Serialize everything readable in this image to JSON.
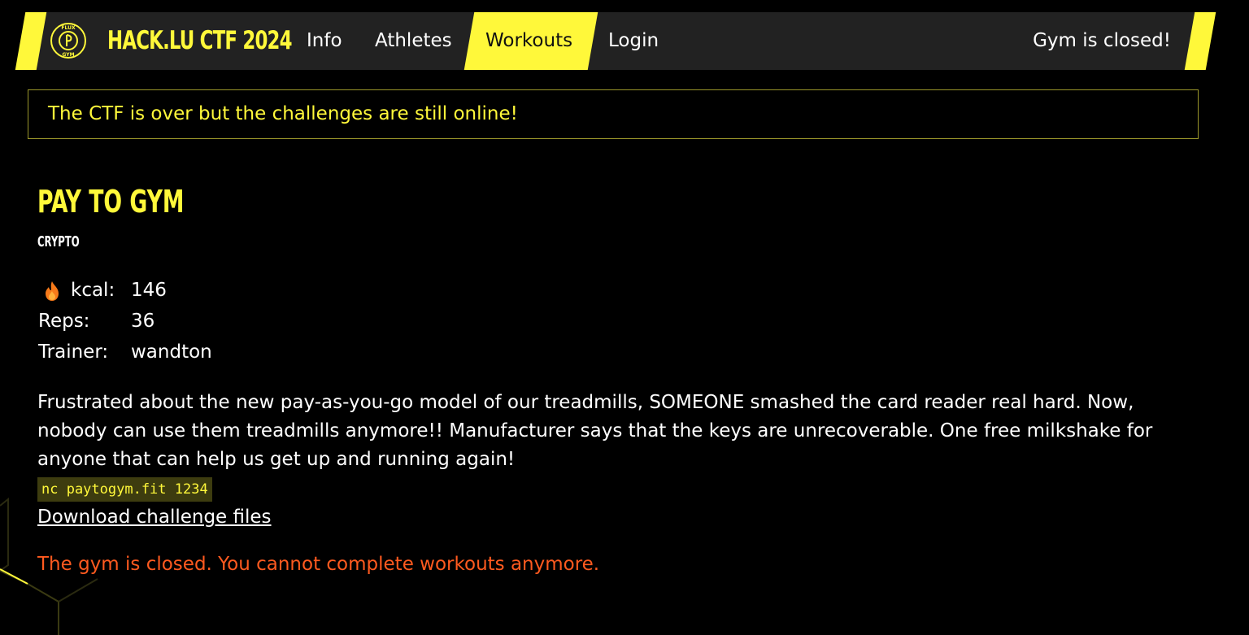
{
  "nav": {
    "brand": "HACK.LU CTF 2024",
    "logo_text": "FLUX GYM",
    "links": [
      {
        "label": "Info"
      },
      {
        "label": "Athletes"
      },
      {
        "label": "Workouts",
        "active": true
      },
      {
        "label": "Login"
      }
    ],
    "status": "Gym is closed!"
  },
  "banner": {
    "text": "The CTF is over but the challenges are still online!"
  },
  "challenge": {
    "title": "PAY TO GYM",
    "category": "CRYPTO",
    "stats": [
      {
        "label": "kcal:",
        "value": "146",
        "icon": "flame-icon"
      },
      {
        "label": "Reps:",
        "value": "36"
      },
      {
        "label": "Trainer:",
        "value": "wandton"
      }
    ],
    "description": "Frustrated about the new pay-as-you-go model of our treadmills, SOMEONE smashed the card reader real hard. Now, nobody can use them treadmills anymore!! Manufacturer says that the keys are unrecoverable. One free milkshake for anyone that can help us get up and running again!",
    "command": "nc paytogym.fit 1234",
    "download_label": "Download challenge files",
    "closed_message": "The gym is closed. You cannot complete workouts anymore."
  },
  "colors": {
    "accent": "#fff83a",
    "background": "#000000",
    "navbar": "#222222",
    "warning": "#ff5a1f"
  }
}
